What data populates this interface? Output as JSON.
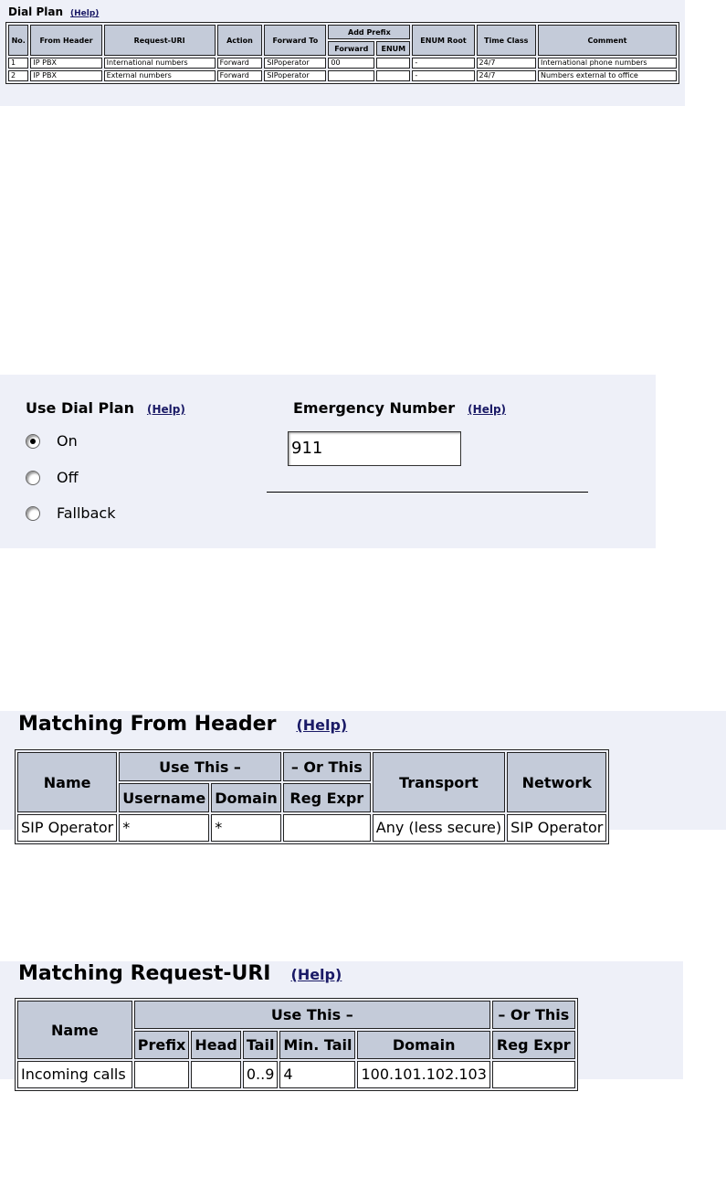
{
  "dial_plan": {
    "title": "Dial Plan",
    "help": "(Help)",
    "headers": {
      "no": "No.",
      "from_header": "From Header",
      "request_uri": "Request-URI",
      "action": "Action",
      "forward_to": "Forward To",
      "add_prefix": "Add Prefix",
      "forward": "Forward",
      "enum": "ENUM",
      "enum_root": "ENUM Root",
      "time_class": "Time Class",
      "comment": "Comment"
    },
    "rows": [
      {
        "no": "1",
        "from_header": "IP PBX",
        "request_uri": "International numbers",
        "action": "Forward",
        "forward_to": "SIPoperator",
        "prefix_forward": "00",
        "prefix_enum": "",
        "enum_root": "-",
        "time_class": "24/7",
        "comment": "International phone numbers"
      },
      {
        "no": "2",
        "from_header": "IP PBX",
        "request_uri": "External numbers",
        "action": "Forward",
        "forward_to": "SIPoperator",
        "prefix_forward": "",
        "prefix_enum": "",
        "enum_root": "-",
        "time_class": "24/7",
        "comment": "Numbers external to office"
      }
    ]
  },
  "use_dial_plan": {
    "title": "Use Dial Plan",
    "help": "(Help)",
    "options": [
      {
        "label": "On",
        "checked": true
      },
      {
        "label": "Off",
        "checked": false
      },
      {
        "label": "Fallback",
        "checked": false
      }
    ]
  },
  "emergency": {
    "title": "Emergency Number",
    "help": "(Help)",
    "value": "911"
  },
  "matching_from_header": {
    "title": "Matching From Header",
    "help": "(Help)",
    "headers": {
      "name": "Name",
      "use_this": "Use This –",
      "or_this": "– Or This",
      "username": "Username",
      "domain": "Domain",
      "reg_expr": "Reg Expr",
      "transport": "Transport",
      "network": "Network"
    },
    "row": {
      "name": "SIP Operator",
      "username": "*",
      "domain": "*",
      "reg_expr": "",
      "transport": "Any (less secure)",
      "network": "SIP Operator"
    }
  },
  "matching_request_uri": {
    "title": "Matching Request-URI",
    "help": "(Help)",
    "headers": {
      "name": "Name",
      "use_this": "Use This –",
      "or_this": "– Or This",
      "prefix": "Prefix",
      "head": "Head",
      "tail": "Tail",
      "min_tail": "Min. Tail",
      "domain": "Domain",
      "reg_expr": "Reg Expr"
    },
    "row": {
      "name": "Incoming calls",
      "prefix": "",
      "head": "",
      "tail": "0..9",
      "min_tail": "4",
      "domain": "100.101.102.103",
      "reg_expr": ""
    }
  }
}
